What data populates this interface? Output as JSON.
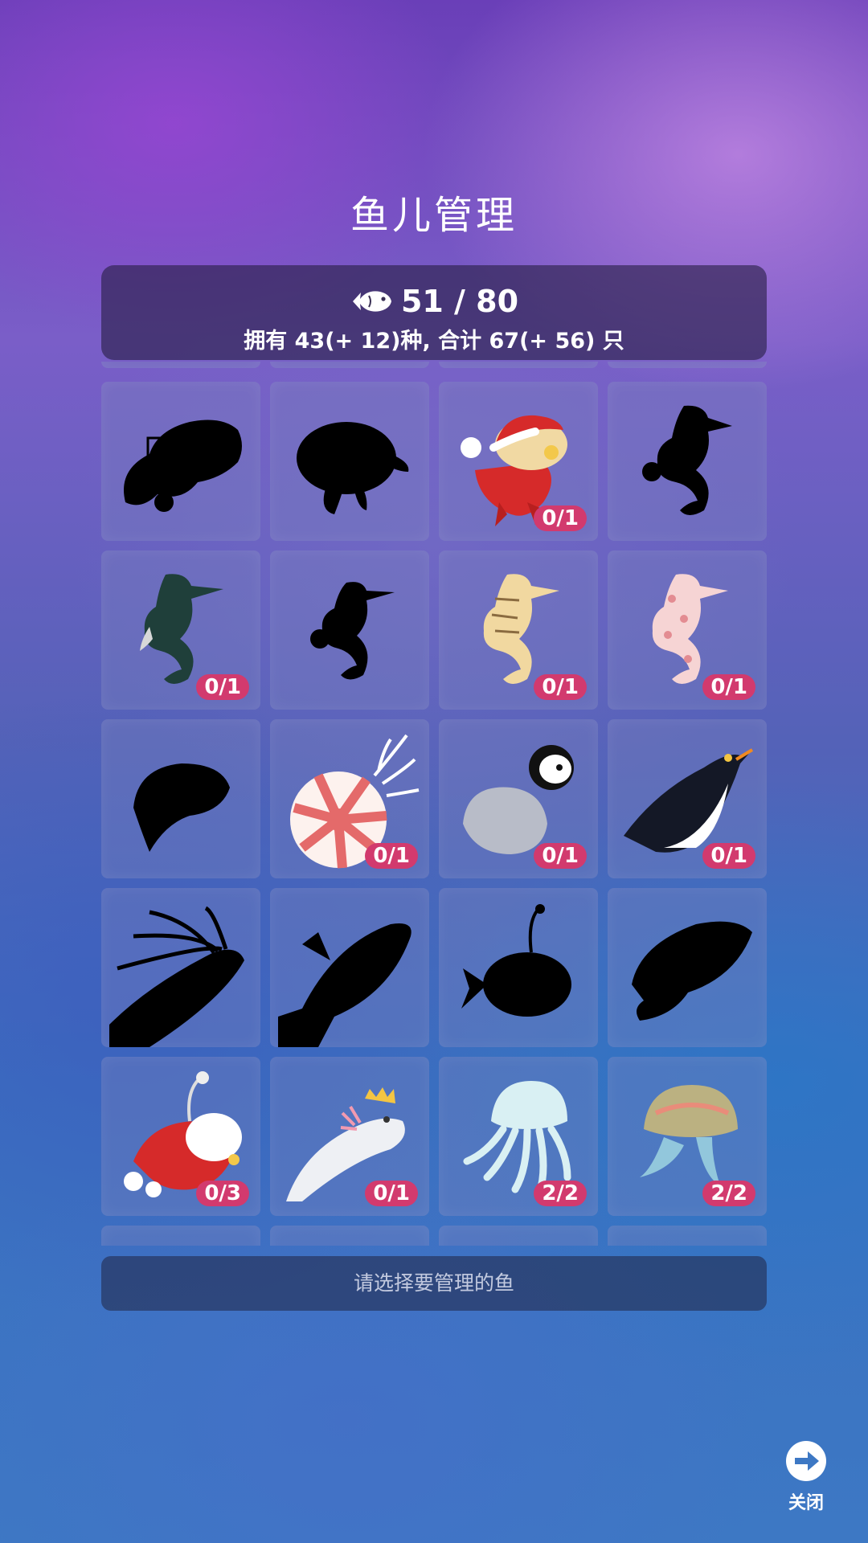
{
  "page": {
    "title": "鱼儿管理"
  },
  "stats": {
    "count": "51 / 80",
    "summary": "拥有 43(+ 12)种, 合计 67(+ 56) 只"
  },
  "grid": {
    "rows": [
      [
        {
          "icon": "anglerfish-silhouette-icon",
          "locked": true,
          "badge": ""
        },
        {
          "icon": "turtle-silhouette-icon",
          "locked": true,
          "badge": ""
        },
        {
          "icon": "santa-hamster-fish-icon",
          "locked": false,
          "badge": "0/1"
        },
        {
          "icon": "seahorse-silhouette-icon",
          "locked": true,
          "badge": ""
        }
      ],
      [
        {
          "icon": "dark-green-seahorse-icon",
          "locked": false,
          "badge": "0/1"
        },
        {
          "icon": "seahorse-silhouette-icon",
          "locked": true,
          "badge": ""
        },
        {
          "icon": "yellow-seahorse-icon",
          "locked": false,
          "badge": "0/1"
        },
        {
          "icon": "pink-seahorse-icon",
          "locked": false,
          "badge": "0/1"
        }
      ],
      [
        {
          "icon": "isopod-silhouette-icon",
          "locked": true,
          "badge": ""
        },
        {
          "icon": "nautilus-icon",
          "locked": false,
          "badge": "0/1"
        },
        {
          "icon": "baby-penguin-icon",
          "locked": false,
          "badge": "0/1"
        },
        {
          "icon": "emperor-penguin-icon",
          "locked": false,
          "badge": "0/1"
        }
      ],
      [
        {
          "icon": "shrimp-silhouette-icon",
          "locked": true,
          "badge": ""
        },
        {
          "icon": "fish-silhouette-icon",
          "locked": true,
          "badge": ""
        },
        {
          "icon": "anglerfish-silhouette-icon",
          "locked": true,
          "badge": ""
        },
        {
          "icon": "fish-silhouette-icon",
          "locked": true,
          "badge": ""
        }
      ],
      [
        {
          "icon": "santa-anglerfish-icon",
          "locked": false,
          "badge": "0/3"
        },
        {
          "icon": "crowned-axolotl-icon",
          "locked": false,
          "badge": "0/1"
        },
        {
          "icon": "white-jellyfish-icon",
          "locked": false,
          "badge": "2/2"
        },
        {
          "icon": "rainbow-jellyfish-icon",
          "locked": false,
          "badge": "2/2"
        }
      ]
    ]
  },
  "hint": "请选择要管理的鱼",
  "close": {
    "label": "关闭",
    "icon": "arrow-right-circle-icon"
  },
  "colors": {
    "badge": "#d23a6e",
    "panel": "#2e2848",
    "silhouette": "#000000"
  }
}
